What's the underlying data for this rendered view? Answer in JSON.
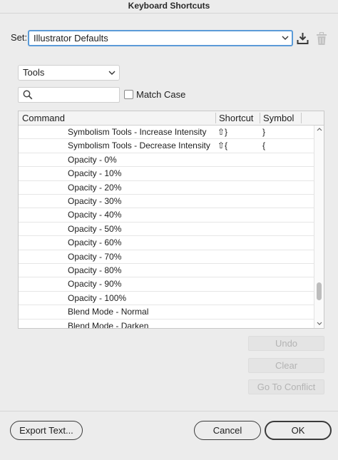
{
  "window": {
    "title": "Keyboard Shortcuts"
  },
  "set": {
    "label": "Set:",
    "value": "Illustrator Defaults"
  },
  "category": {
    "value": "Tools"
  },
  "search": {
    "placeholder": "",
    "match_case_label": "Match Case",
    "match_case_checked": false
  },
  "table": {
    "columns": [
      "Command",
      "Shortcut",
      "Symbol"
    ],
    "rows": [
      {
        "command": "Symbolism Tools - Increase Intensity",
        "shortcut": "⇧}",
        "symbol": "}"
      },
      {
        "command": "Symbolism Tools - Decrease Intensity",
        "shortcut": "⇧{",
        "symbol": "{"
      },
      {
        "command": "Opacity - 0%",
        "shortcut": "",
        "symbol": ""
      },
      {
        "command": "Opacity - 10%",
        "shortcut": "",
        "symbol": ""
      },
      {
        "command": "Opacity - 20%",
        "shortcut": "",
        "symbol": ""
      },
      {
        "command": "Opacity - 30%",
        "shortcut": "",
        "symbol": ""
      },
      {
        "command": "Opacity - 40%",
        "shortcut": "",
        "symbol": ""
      },
      {
        "command": "Opacity - 50%",
        "shortcut": "",
        "symbol": ""
      },
      {
        "command": "Opacity - 60%",
        "shortcut": "",
        "symbol": ""
      },
      {
        "command": "Opacity - 70%",
        "shortcut": "",
        "symbol": ""
      },
      {
        "command": "Opacity - 80%",
        "shortcut": "",
        "symbol": ""
      },
      {
        "command": "Opacity - 90%",
        "shortcut": "",
        "symbol": ""
      },
      {
        "command": "Opacity - 100%",
        "shortcut": "",
        "symbol": ""
      },
      {
        "command": "Blend Mode - Normal",
        "shortcut": "",
        "symbol": ""
      },
      {
        "command": "Blend Mode - Darken",
        "shortcut": "",
        "symbol": ""
      }
    ]
  },
  "side_buttons": {
    "undo": "Undo",
    "clear": "Clear",
    "go_to_conflict": "Go To Conflict"
  },
  "footer": {
    "export": "Export Text...",
    "cancel": "Cancel",
    "ok": "OK"
  },
  "icons": {
    "save": "save-set-icon",
    "delete": "trash-icon",
    "search": "search-icon",
    "dropdown": "chevron-down-icon"
  },
  "colors": {
    "focus_ring": "#5b9bd8",
    "background": "#ececec"
  }
}
